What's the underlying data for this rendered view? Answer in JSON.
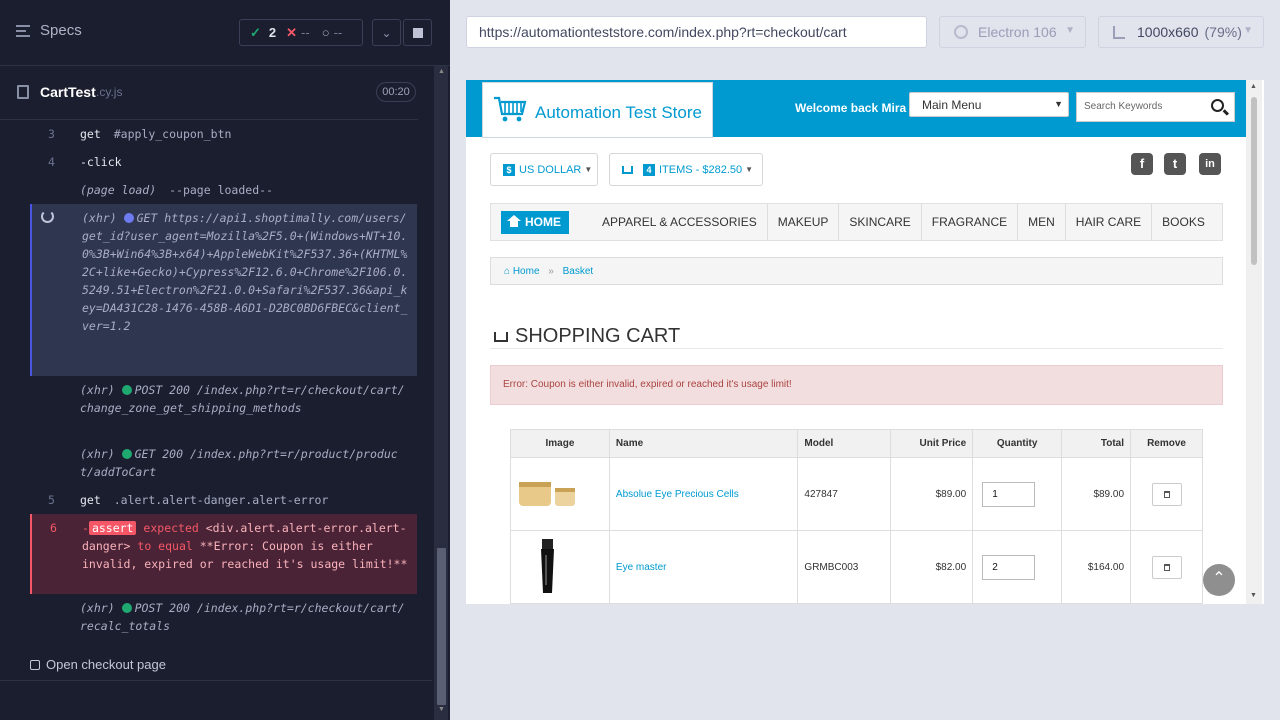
{
  "runner": {
    "specs_label": "Specs",
    "stats": {
      "pass_icon": "✓",
      "passed": "2",
      "fail_icon": "✕",
      "failed": "--",
      "pending_icon": "○",
      "pending": "--"
    },
    "spec": {
      "name": "CartTest",
      "ext": ".cy.js",
      "duration": "00:20"
    },
    "commands": [
      {
        "num": "3",
        "name": "get",
        "detail": "#apply_coupon_btn"
      },
      {
        "num": "4",
        "name": "-click",
        "detail": ""
      },
      {
        "num": "",
        "name": "(page load)",
        "detail": "--page loaded--"
      },
      {
        "type": "(xhr)",
        "method": "GET",
        "text": "https://api1.shoptimally.com/users/get_id?user_agent=Mozilla%2F5.0+(Windows+NT+10.0%3B+Win64%3B+x64)+AppleWebKit%2F537.36+(KHTML%2C+like+Gecko)+Cypress%2F12.6.0+Chrome%2F106.0.5249.51+Electron%2F21.0.0+Safari%2F537.36&api_key=DA431C28-1476-458B-A6D1-D2BC0BD6FBEC&client_ver=1.2"
      },
      {
        "type": "(xhr)",
        "method": "POST 200",
        "text": "/index.php?rt=r/checkout/cart/change_zone_get_shipping_methods"
      },
      {
        "type": "(xhr)",
        "method": "GET 200",
        "text": "/index.php?rt=r/product/product/addToCart"
      },
      {
        "num": "5",
        "name": "get",
        "detail": ".alert.alert-danger.alert-error"
      },
      {
        "num": "6",
        "dash": "-",
        "tag": "assert",
        "expected": "expected",
        "subject": "<div.alert.alert-error.alert-danger>",
        "to_equal": "to equal",
        "value": "**Error: Coupon is either invalid, expired or reached it's usage limit!**"
      },
      {
        "type": "(xhr)",
        "method": "POST 200",
        "text": "/index.php?rt=r/checkout/cart/recalc_totals"
      }
    ],
    "next_test": "Open checkout page"
  },
  "preview": {
    "url": "https://automationteststore.com/index.php?rt=checkout/cart",
    "browser": "Electron 106",
    "viewport": "1000x660",
    "zoom": "(79%)"
  },
  "site": {
    "logo_text": "Automation Test Store",
    "welcome": "Welcome back Mira",
    "main_menu": "Main Menu",
    "search_placeholder": "Search Keywords",
    "currency_symbol": "$",
    "currency": "US DOLLAR",
    "cart_count": "4",
    "cart_summary": "ITEMS - $282.50",
    "social": {
      "facebook": "f",
      "twitter": "t",
      "linkedin": "in"
    },
    "nav": [
      "HOME",
      "APPAREL & ACCESSORIES",
      "MAKEUP",
      "SKINCARE",
      "FRAGRANCE",
      "MEN",
      "HAIR CARE",
      "BOOKS"
    ],
    "breadcrumbs": [
      "Home",
      "Basket"
    ],
    "page_title": "SHOPPING CART",
    "alert": "Error: Coupon is either invalid, expired or reached it's usage limit!",
    "table": {
      "headers": [
        "Image",
        "Name",
        "Model",
        "Unit Price",
        "Quantity",
        "Total",
        "Remove"
      ],
      "rows": [
        {
          "name": "Absolue Eye Precious Cells",
          "model": "427847",
          "unit_price": "$89.00",
          "qty": "1",
          "total": "$89.00"
        },
        {
          "name": "Eye master",
          "model": "GRMBC003",
          "unit_price": "$82.00",
          "qty": "2",
          "total": "$164.00"
        }
      ]
    }
  }
}
